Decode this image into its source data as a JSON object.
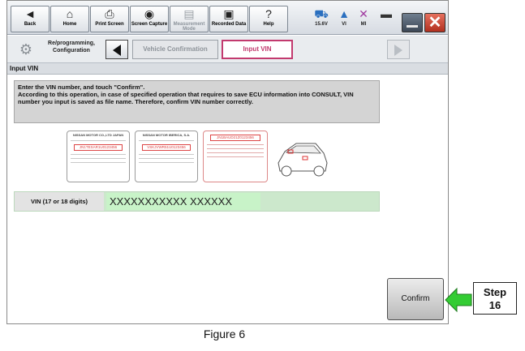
{
  "toolbar": {
    "buttons": [
      {
        "label": "Back",
        "icon": "back-arrow-icon"
      },
      {
        "label": "Home",
        "icon": "home-icon"
      },
      {
        "label": "Print Screen",
        "icon": "printer-icon"
      },
      {
        "label": "Screen Capture",
        "icon": "camera-icon"
      },
      {
        "label": "Measurement Mode",
        "icon": "meter-icon"
      },
      {
        "label": "Recorded Data",
        "icon": "film-icon"
      },
      {
        "label": "Help",
        "icon": "help-icon"
      }
    ],
    "status": [
      {
        "label": "15.6V",
        "icon": "vehicle-icon"
      },
      {
        "label": "VI",
        "icon": "signal-icon"
      },
      {
        "label": "MI",
        "icon": "x-icon"
      }
    ]
  },
  "nav": {
    "title": "Re/programming, Configuration",
    "crumbs": [
      "Vehicle Confirmation",
      "Input VIN"
    ]
  },
  "section_title": "Input VIN",
  "instructions": "Enter the VIN number, and touch \"Confirm\".\nAccording to this operation, in case of specified operation that requires to save ECU information into CONSULT, VIN number you input is saved as file name. Therefore, confirm VIN number correctly.",
  "plates": [
    {
      "header": "NISSAN MOTOR CO.,LTD JAPAN",
      "vin": "JN1TESAR1U0123456"
    },
    {
      "header": "NISSAN MOTOR IBERICA, S.A.",
      "vin": "VSKJVWR51U0123456"
    },
    {
      "header": "",
      "vin": "JN1BAUD21Z0123456"
    }
  ],
  "vin": {
    "label": "VIN (17 or 18 digits)",
    "value": "XXXXXXXXXXX XXXXXX"
  },
  "confirm_label": "Confirm",
  "annotation": {
    "step_line1": "Step",
    "step_line2": "16",
    "caption": "Figure 6"
  },
  "colors": {
    "vin_row_bg": "#cce8cc",
    "arrow": "#33cc33",
    "active_crumb": "#c23a6e"
  }
}
